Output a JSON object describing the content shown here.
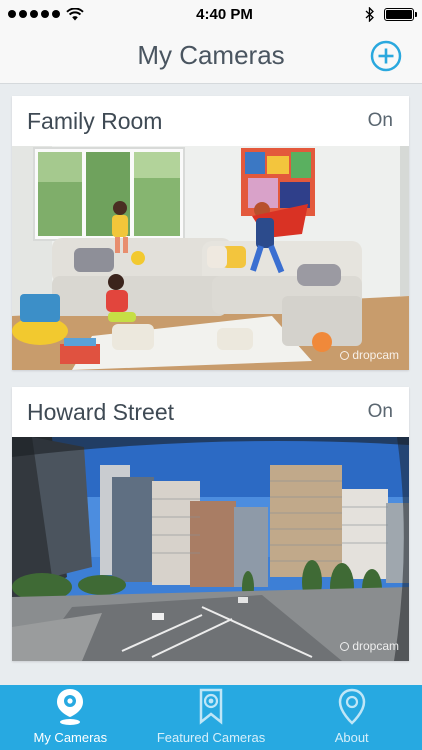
{
  "status_bar": {
    "time": "4:40 PM",
    "signal_dots": 5,
    "icons": [
      "wifi-icon",
      "bluetooth-icon",
      "battery-icon"
    ],
    "battery_level": 1.0
  },
  "nav": {
    "title": "My Cameras",
    "add_icon": "plus-circle-icon"
  },
  "cameras": [
    {
      "name": "Family Room",
      "status": "On",
      "watermark": "dropcam"
    },
    {
      "name": "Howard Street",
      "status": "On",
      "watermark": "dropcam"
    }
  ],
  "tabs": [
    {
      "label": "My Cameras",
      "icon": "camera-pin-icon",
      "active": true
    },
    {
      "label": "Featured Cameras",
      "icon": "ribbon-icon",
      "active": false
    },
    {
      "label": "About",
      "icon": "location-pin-icon",
      "active": false
    }
  ],
  "colors": {
    "accent": "#27a9e1",
    "add_button": "#2aa8de",
    "background": "#e8ecef",
    "title_text": "#4a5560"
  }
}
